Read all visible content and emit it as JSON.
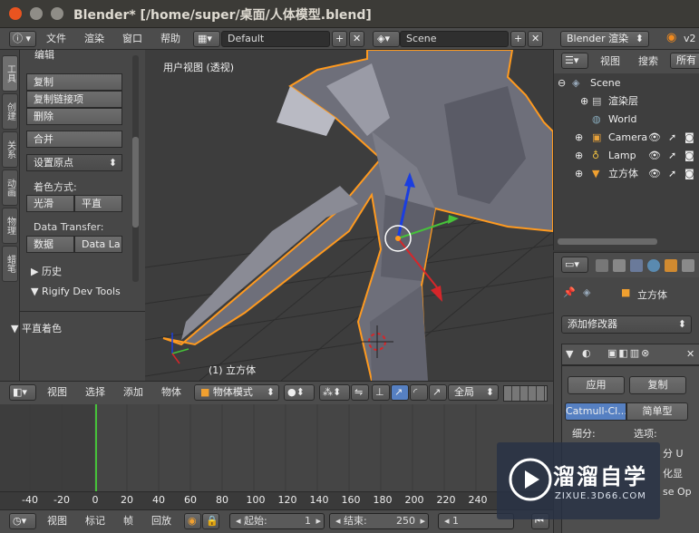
{
  "window": {
    "title": "Blender* [/home/super/桌面/人体模型.blend]"
  },
  "info_header": {
    "menus": [
      "文件",
      "渲染",
      "窗口",
      "帮助"
    ],
    "layout": "Default",
    "scene": "Scene",
    "engine": "Blender 渲染",
    "version": "v2"
  },
  "tool_tabs": [
    "工具",
    "创建",
    "关系",
    "动画",
    "物理",
    "蜡笔"
  ],
  "tool_shelf": {
    "section_title": "编辑",
    "buttons": [
      "复制",
      "复制链接项",
      "删除"
    ],
    "join": "合并",
    "set_origin": "设置原点",
    "shading_label": "着色方式:",
    "smooth": "光滑",
    "flat": "平直",
    "data_transfer_label": "Data Transfer:",
    "data_btn": "数据",
    "data_layers_btn": "Data La",
    "history": "历史",
    "rigify": "Rigify Dev Tools",
    "flat_shading_panel": "平直着色"
  },
  "viewport": {
    "view_name": "用户视图 (透视)",
    "object_label": "(1) 立方体"
  },
  "viewport_header": {
    "menus": [
      "视图",
      "选择",
      "添加",
      "物体"
    ],
    "mode": "物体模式",
    "pivot": "全局"
  },
  "timeline": {
    "ruler_ticks": [
      "-40",
      "-20",
      "0",
      "20",
      "40",
      "60",
      "80",
      "100",
      "120",
      "140",
      "160",
      "180",
      "200",
      "220",
      "240"
    ],
    "menus": [
      "视图",
      "标记",
      "帧",
      "回放"
    ],
    "start_label": "起始:",
    "start_value": "1",
    "end_label": "结束:",
    "end_value": "250",
    "current_frame": "1"
  },
  "outliner": {
    "menus": [
      "视图",
      "搜索",
      "所有"
    ],
    "rows": [
      "Scene",
      "渲染层",
      "World",
      "Camera",
      "Lamp",
      "立方体"
    ]
  },
  "properties": {
    "object_name": "立方体",
    "add_modifier": "添加修改器",
    "apply": "应用",
    "copy": "复制",
    "catmull": "Catmull-Cl...",
    "simple": "简单型",
    "subdivisions": "细分:",
    "options": "选项:",
    "partial_1": "分 U",
    "partial_2": "化显",
    "partial_3": "se Op"
  },
  "watermark": {
    "name": "溜溜自学",
    "url": "ZIXUE.3D66.COM"
  },
  "colors": {
    "selection_outline": "#ff9a1f",
    "x_axis": "#d6262a",
    "y_axis": "#46c23a",
    "z_axis": "#1b3ee0",
    "active_button": "#5680c2"
  }
}
